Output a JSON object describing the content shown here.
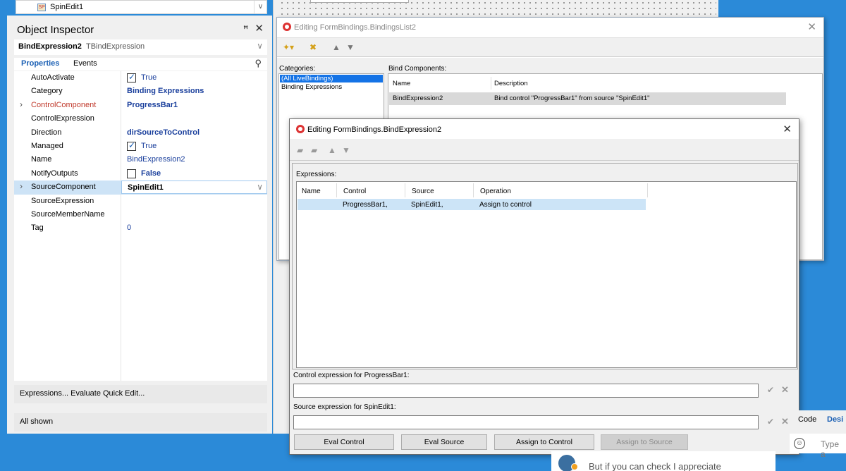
{
  "top_combo": {
    "text": "SpinEdit1"
  },
  "object_inspector": {
    "title": "Object Inspector",
    "component_name": "BindExpression2",
    "component_type": "TBindExpression",
    "tabs": [
      "Properties",
      "Events"
    ],
    "properties": [
      {
        "name": "AutoActivate",
        "value": "True",
        "checkbox": true,
        "checked": true
      },
      {
        "name": "Category",
        "value": "Binding Expressions"
      },
      {
        "name": "ControlComponent",
        "value": "ProgressBar1",
        "expandable": true
      },
      {
        "name": "ControlExpression",
        "value": ""
      },
      {
        "name": "Direction",
        "value": "dirSourceToControl"
      },
      {
        "name": "Managed",
        "value": "True",
        "checkbox": true,
        "checked": true
      },
      {
        "name": "Name",
        "value": "BindExpression2"
      },
      {
        "name": "NotifyOutputs",
        "value": "False",
        "checkbox": true,
        "checked": false
      },
      {
        "name": "SourceComponent",
        "value": "SpinEdit1",
        "expandable": true,
        "selected": true
      },
      {
        "name": "SourceExpression",
        "value": ""
      },
      {
        "name": "SourceMemberName",
        "value": ""
      },
      {
        "name": "Tag",
        "value": "0"
      }
    ],
    "footer_actions": "Expressions...  Evaluate  Quick Edit...",
    "status": "All shown"
  },
  "bindings_list": {
    "title": "Editing FormBindings.BindingsList2",
    "categories_label": "Categories:",
    "categories": [
      "(All LiveBindings)",
      "Binding Expressions"
    ],
    "bind_components_label": "Bind Components:",
    "columns": [
      "Name",
      "Description"
    ],
    "rows": [
      {
        "name": "BindExpression2",
        "description": "Bind control \"ProgressBar1\" from source \"SpinEdit1\""
      }
    ]
  },
  "bind_expression": {
    "title": "Editing FormBindings.BindExpression2",
    "expressions_label": "Expressions:",
    "columns": [
      "Name",
      "Control",
      "Source",
      "Operation"
    ],
    "rows": [
      {
        "name": "",
        "control": "ProgressBar1,",
        "source": "SpinEdit1,",
        "operation": "Assign to control"
      }
    ],
    "control_expr_label": "Control expression for ProgressBar1:",
    "control_expr_value": "",
    "source_expr_label": "Source expression for SpinEdit1:",
    "source_expr_value": "",
    "buttons": {
      "eval_control": "Eval Control",
      "eval_source": "Eval Source",
      "assign_to_control": "Assign to Control",
      "assign_to_source": "Assign to Source"
    }
  },
  "editor_tabs": {
    "code": "Code",
    "design": "Desi"
  },
  "chat": {
    "message": "But if you can check I appreciate"
  },
  "type_box": {
    "placeholder": "Type a"
  },
  "colors": {
    "accent": "#1a5fb4",
    "desktop": "#2b8ad8",
    "selection": "#cde3f6"
  }
}
